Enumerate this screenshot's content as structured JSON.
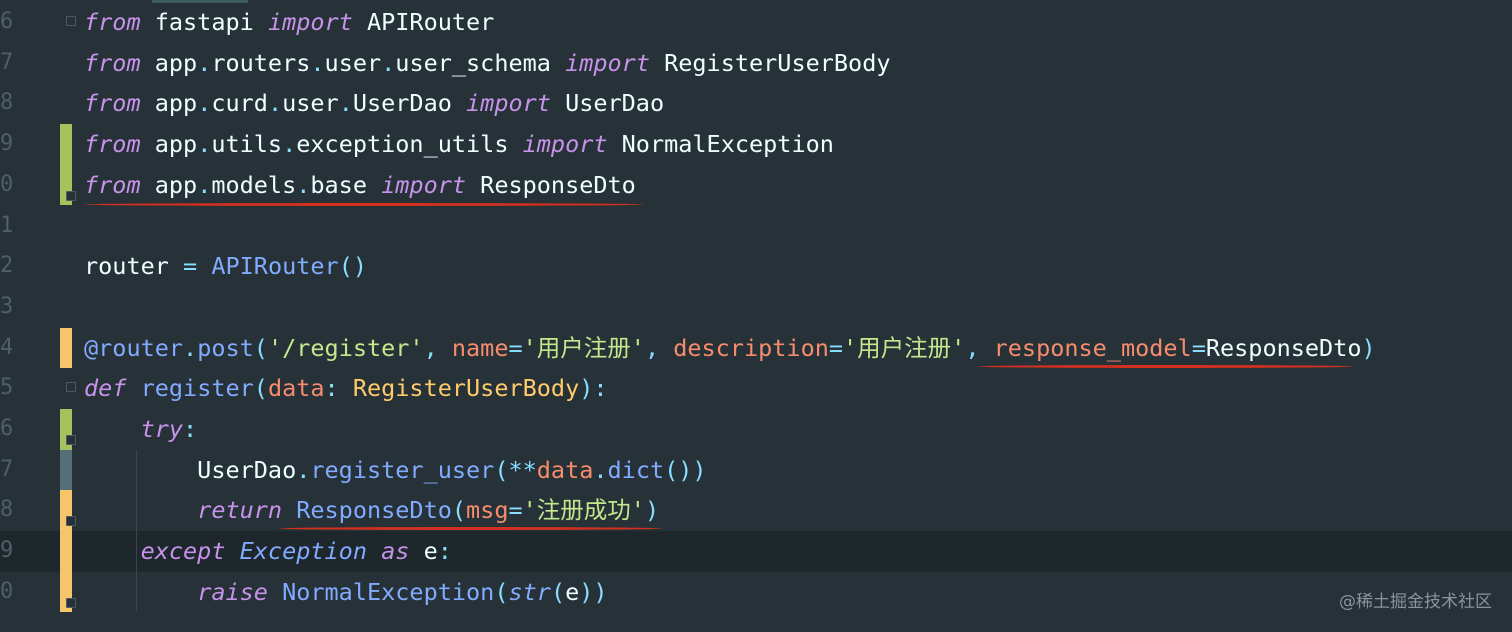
{
  "editor": {
    "lines": [
      {
        "number": "6",
        "tokens": [
          [
            "kw",
            "from"
          ],
          [
            "txt",
            " fastapi "
          ],
          [
            "kw",
            "import"
          ],
          [
            "txt",
            " APIRouter"
          ]
        ]
      },
      {
        "number": "7",
        "tokens": [
          [
            "kw",
            "from"
          ],
          [
            "txt",
            " app"
          ],
          [
            "dot",
            "."
          ],
          [
            "txt",
            "routers"
          ],
          [
            "dot",
            "."
          ],
          [
            "txt",
            "user"
          ],
          [
            "dot",
            "."
          ],
          [
            "txt",
            "user_schema "
          ],
          [
            "kw",
            "import"
          ],
          [
            "txt",
            " RegisterUserBody"
          ]
        ]
      },
      {
        "number": "8",
        "tokens": [
          [
            "kw",
            "from"
          ],
          [
            "txt",
            " app"
          ],
          [
            "dot",
            "."
          ],
          [
            "txt",
            "curd"
          ],
          [
            "dot",
            "."
          ],
          [
            "txt",
            "user"
          ],
          [
            "dot",
            "."
          ],
          [
            "txt",
            "UserDao "
          ],
          [
            "kw",
            "import"
          ],
          [
            "txt",
            " UserDao"
          ]
        ]
      },
      {
        "number": "9",
        "tokens": [
          [
            "kw",
            "from"
          ],
          [
            "txt",
            " app"
          ],
          [
            "dot",
            "."
          ],
          [
            "txt",
            "utils"
          ],
          [
            "dot",
            "."
          ],
          [
            "txt",
            "exception_utils "
          ],
          [
            "kw",
            "import"
          ],
          [
            "txt",
            " NormalException"
          ]
        ]
      },
      {
        "number": "0",
        "tokens": [
          [
            "kw",
            "from"
          ],
          [
            "txt",
            " app"
          ],
          [
            "dot",
            "."
          ],
          [
            "txt",
            "models"
          ],
          [
            "dot",
            "."
          ],
          [
            "txt",
            "base "
          ],
          [
            "kw",
            "import"
          ],
          [
            "txt",
            " ResponseDto"
          ]
        ]
      },
      {
        "number": "1",
        "tokens": []
      },
      {
        "number": "2",
        "tokens": [
          [
            "txt",
            "router "
          ],
          [
            "punc",
            "="
          ],
          [
            "txt",
            " "
          ],
          [
            "fn",
            "APIRouter"
          ],
          [
            "punc",
            "()"
          ]
        ]
      },
      {
        "number": "3",
        "tokens": []
      },
      {
        "number": "4",
        "tokens": [
          [
            "deco",
            "@router"
          ],
          [
            "dot",
            "."
          ],
          [
            "deco",
            "post"
          ],
          [
            "punc",
            "("
          ],
          [
            "str",
            "'/register'"
          ],
          [
            "punc",
            ", "
          ],
          [
            "param",
            "name"
          ],
          [
            "punc",
            "="
          ],
          [
            "str",
            "'用户注册'"
          ],
          [
            "punc",
            ", "
          ],
          [
            "param",
            "description"
          ],
          [
            "punc",
            "="
          ],
          [
            "str",
            "'用户注册'"
          ],
          [
            "punc",
            ", "
          ],
          [
            "param",
            "response_model"
          ],
          [
            "punc",
            "="
          ],
          [
            "txt",
            "ResponseDto"
          ],
          [
            "punc",
            ")"
          ]
        ]
      },
      {
        "number": "5",
        "tokens": [
          [
            "kw",
            "def"
          ],
          [
            "txt",
            " "
          ],
          [
            "fn",
            "register"
          ],
          [
            "punc",
            "("
          ],
          [
            "param",
            "data"
          ],
          [
            "punc",
            ": "
          ],
          [
            "cls",
            "RegisterUserBody"
          ],
          [
            "punc",
            "):"
          ]
        ]
      },
      {
        "number": "6",
        "tokens": [
          [
            "txt",
            "    "
          ],
          [
            "kw",
            "try"
          ],
          [
            "punc",
            ":"
          ]
        ]
      },
      {
        "number": "7",
        "tokens": [
          [
            "txt",
            "        UserDao"
          ],
          [
            "dot",
            "."
          ],
          [
            "fn",
            "register_user"
          ],
          [
            "punc",
            "(**"
          ],
          [
            "param",
            "data"
          ],
          [
            "dot",
            "."
          ],
          [
            "fn",
            "dict"
          ],
          [
            "punc",
            "())"
          ]
        ]
      },
      {
        "number": "8",
        "tokens": [
          [
            "txt",
            "        "
          ],
          [
            "kw",
            "return"
          ],
          [
            "txt",
            " "
          ],
          [
            "fn",
            "ResponseDto"
          ],
          [
            "punc",
            "("
          ],
          [
            "param",
            "msg"
          ],
          [
            "punc",
            "="
          ],
          [
            "str",
            "'注册成功'"
          ],
          [
            "punc",
            ")"
          ]
        ]
      },
      {
        "number": "9",
        "tokens": [
          [
            "txt",
            "    "
          ],
          [
            "kw",
            "except"
          ],
          [
            "txt",
            " "
          ],
          [
            "builtin",
            "Exception"
          ],
          [
            "txt",
            " "
          ],
          [
            "kw",
            "as"
          ],
          [
            "txt",
            " e"
          ],
          [
            "punc",
            ":"
          ]
        ]
      },
      {
        "number": "0",
        "tokens": [
          [
            "txt",
            "        "
          ],
          [
            "kw",
            "raise"
          ],
          [
            "txt",
            " "
          ],
          [
            "fn",
            "NormalException"
          ],
          [
            "punc",
            "("
          ],
          [
            "builtin",
            "str"
          ],
          [
            "punc",
            "("
          ],
          [
            "txt",
            "e"
          ],
          [
            "punc",
            "))"
          ]
        ]
      }
    ]
  },
  "watermark": "@稀土掘金技术社区",
  "colors": {
    "background": "#263238",
    "keyword": "#c792ea",
    "function": "#82aaff",
    "string": "#c3e88d",
    "parameter": "#f78c6c",
    "class": "#ffcb6b",
    "annotation_underline": "#d4301f",
    "added_marker": "#a5c25c",
    "modified_marker": "#f6c46a"
  }
}
